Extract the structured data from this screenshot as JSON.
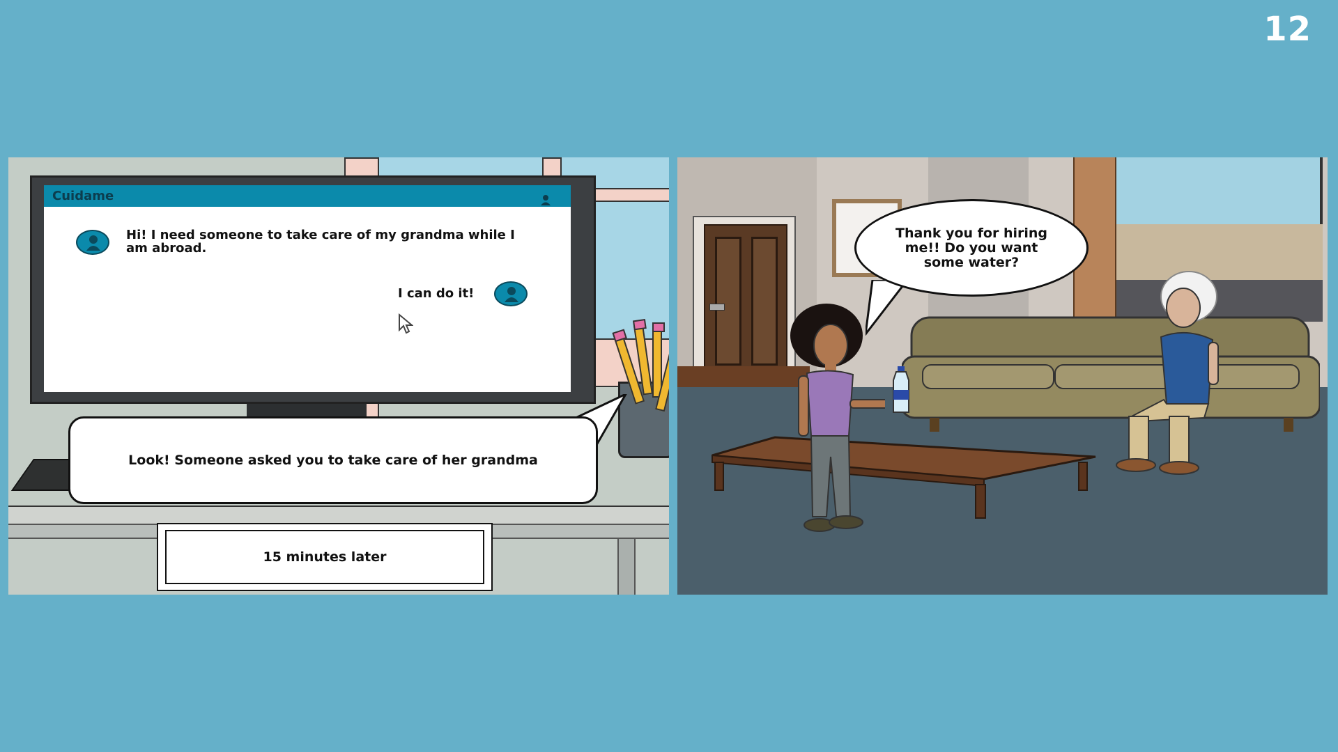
{
  "slide": {
    "number": "12"
  },
  "left_panel": {
    "app": {
      "title": "Cuidame",
      "messages": [
        {
          "text": "Hi! I need someone to take care of my grandma while I am abroad."
        },
        {
          "text": "I can do it!"
        }
      ]
    },
    "speech_bubble": "Look! Someone asked you to take care of her grandma",
    "caption": "15 minutes later"
  },
  "right_panel": {
    "speech_bubble": "Thank you for hiring me!! Do you want some water?"
  },
  "colors": {
    "background": "#65b0c9",
    "app_accent": "#0b8aab"
  }
}
